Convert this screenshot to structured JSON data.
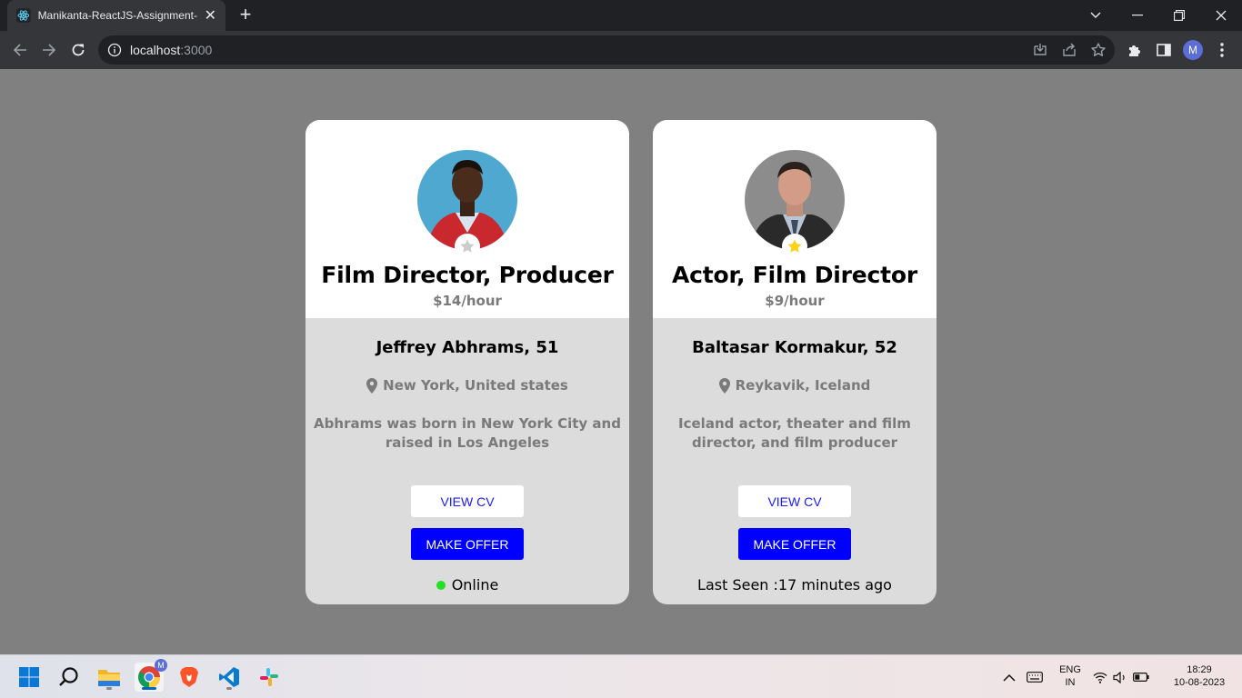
{
  "browser": {
    "tab_title": "Manikanta-ReactJS-Assignment-",
    "url_host": "localhost",
    "url_port": ":3000",
    "profile_initial": "M"
  },
  "cards": [
    {
      "profession": "Film Director, Producer",
      "rate": "$14/hour",
      "name": "Jeffrey Abhrams, 51",
      "location": "New York, United states",
      "description": "Abhrams was born in New York City and raised in Los Angeles",
      "view_cv_label": "VIEW CV",
      "make_offer_label": "MAKE OFFER",
      "status_text": "Online",
      "online": true,
      "favorite": false
    },
    {
      "profession": "Actor, Film Director",
      "rate": "$9/hour",
      "name": "Baltasar Kormakur, 52",
      "location": "Reykavik, Iceland",
      "description": "Iceland actor, theater and film director, and film producer",
      "view_cv_label": "VIEW CV",
      "make_offer_label": "MAKE OFFER",
      "status_text": "Last Seen :17 minutes ago",
      "online": false,
      "favorite": true
    }
  ],
  "colors": {
    "page_bg": "#808080",
    "offer_button": "#0000ff",
    "online_dot": "#22e022",
    "star_active": "#ffd21a",
    "star_inactive": "#cccccc"
  },
  "taskbar": {
    "language_top": "ENG",
    "language_bottom": "IN",
    "time": "18:29",
    "date": "10-08-2023",
    "chrome_badge": "M"
  }
}
